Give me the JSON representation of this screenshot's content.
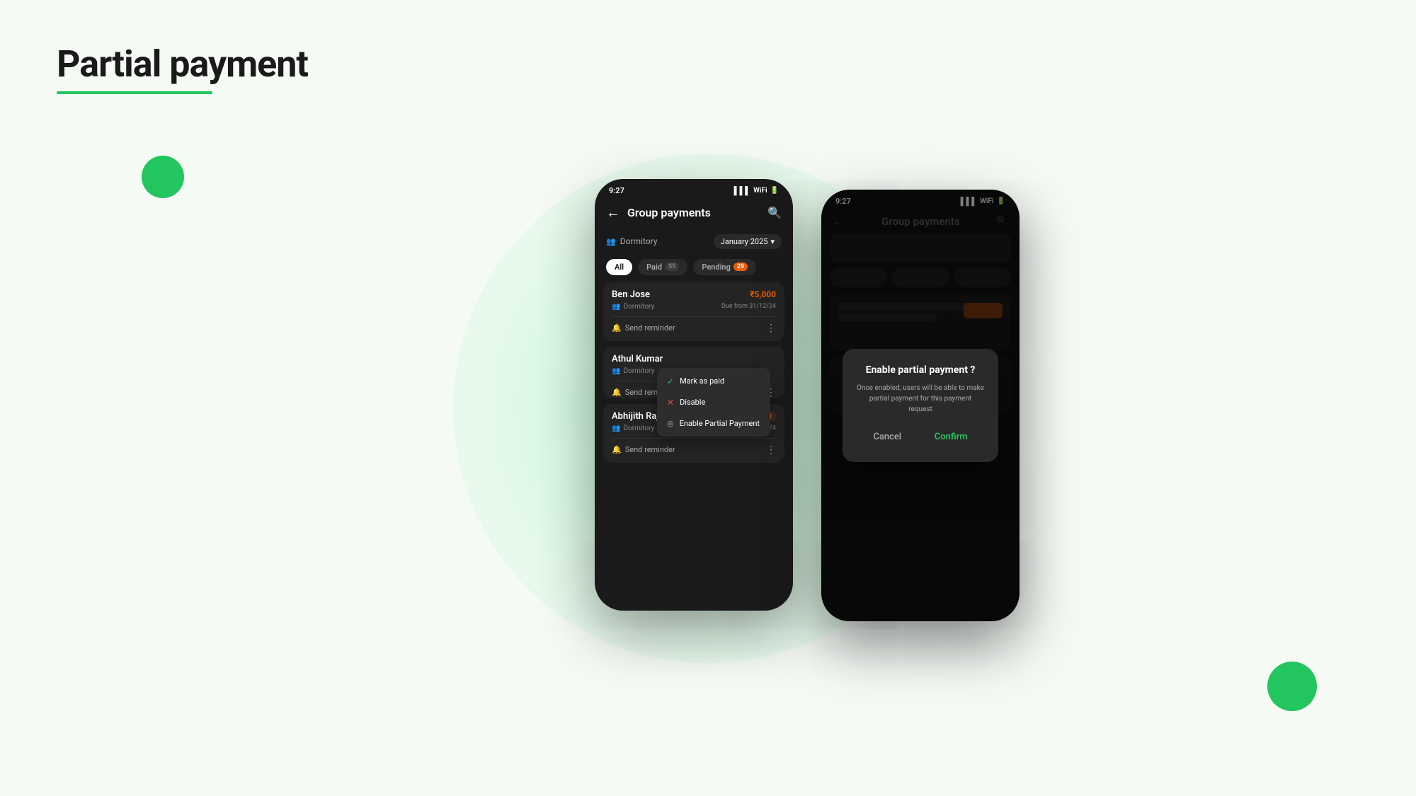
{
  "page": {
    "title": "Partial payment",
    "underline_color": "#22c55e",
    "bg_color": "#f5faf5"
  },
  "decorations": {
    "circle_left_color": "#22c55e",
    "circle_right_color": "#22c55e"
  },
  "phone1": {
    "status_time": "9:27",
    "header_title": "Group payments",
    "dormitory_label": "Dormitory",
    "month_selector": "January 2025",
    "tabs": {
      "all": "All",
      "paid": "Paid",
      "paid_count": "55",
      "pending": "Pending",
      "pending_count": "29"
    },
    "cards": [
      {
        "name": "Ben Jose",
        "location": "Dormitory",
        "amount": "₹5,000",
        "due": "Due from 31/12/24",
        "action": "Send reminder"
      },
      {
        "name": "Athul Kumar",
        "location": "Dormitory",
        "amount": "",
        "due": "",
        "action": "Send reminder",
        "has_menu": true
      },
      {
        "name": "Abhijith Raj",
        "location": "Dormitory",
        "amount": "₹5,000",
        "due": "Due from 31/12/24",
        "action": "Send reminder",
        "partial": true
      }
    ],
    "context_menu": {
      "mark_paid": "Mark as paid",
      "disable": "Disable",
      "enable_partial": "Enable Partial Payment"
    }
  },
  "phone2": {
    "status_time": "9:27",
    "header_title": "Group payments",
    "dialog": {
      "title": "Enable partial payment ?",
      "description": "Once enabled, users will be able to make partial payment for this payment request",
      "cancel_label": "Cancel",
      "confirm_label": "Confirm"
    }
  }
}
